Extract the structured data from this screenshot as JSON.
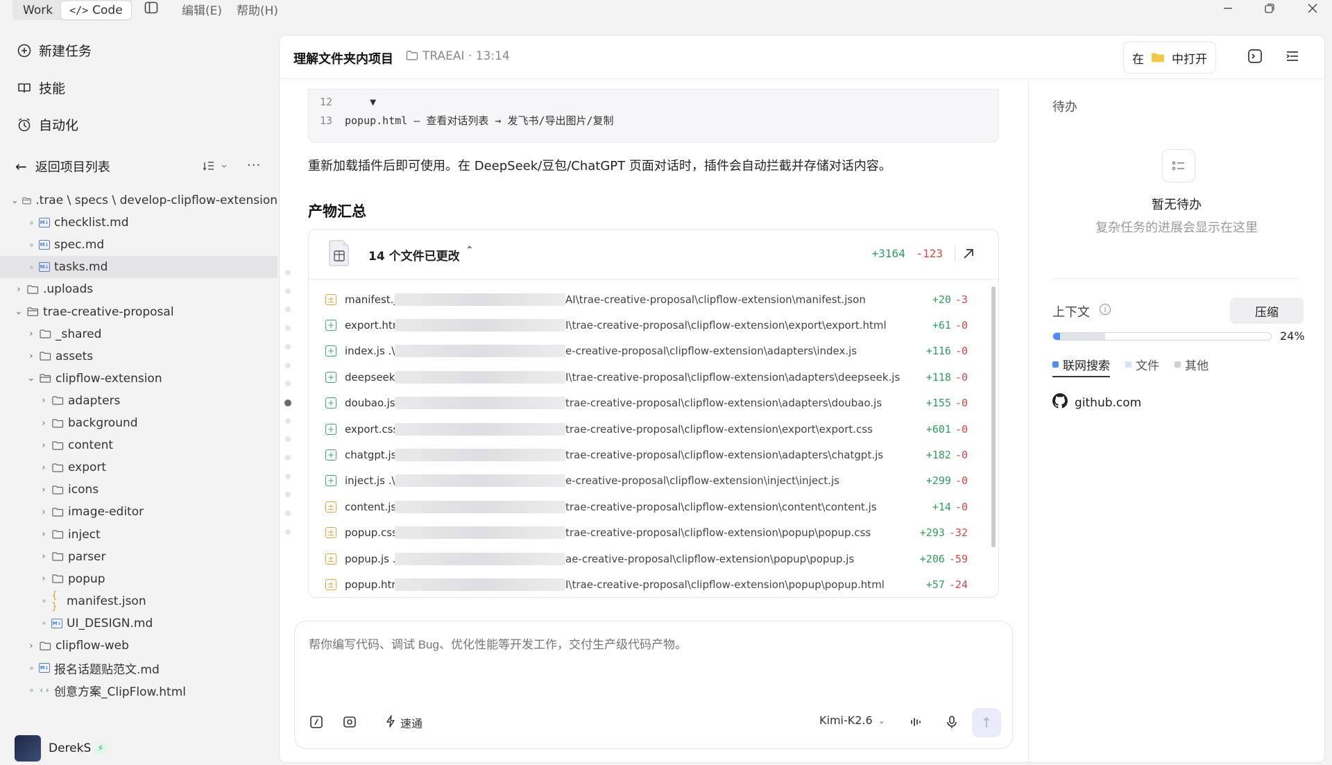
{
  "titlebar": {
    "mode_work": "Work",
    "mode_code": "Code",
    "menu_edit": "编辑(E)",
    "menu_help": "帮助(H)"
  },
  "sidebar": {
    "nav": [
      {
        "label": "新建任务",
        "icon": "plus-circle-icon"
      },
      {
        "label": "技能",
        "icon": "book-icon"
      },
      {
        "label": "自动化",
        "icon": "clock-icon"
      }
    ],
    "back_label": "返回项目列表",
    "tree": [
      {
        "label": ".trae \\ specs \\ develop-clipflow-extension",
        "type": "folder",
        "expanded": true
      },
      {
        "label": "checklist.md",
        "type": "md"
      },
      {
        "label": "spec.md",
        "type": "md"
      },
      {
        "label": "tasks.md",
        "type": "md",
        "selected": true
      },
      {
        "label": ".uploads",
        "type": "folder",
        "expanded": false
      },
      {
        "label": "trae-creative-proposal",
        "type": "folder",
        "expanded": true
      },
      {
        "label": "_shared",
        "type": "folder",
        "expanded": false
      },
      {
        "label": "assets",
        "type": "folder",
        "expanded": false
      },
      {
        "label": "clipflow-extension",
        "type": "folder",
        "expanded": true
      },
      {
        "label": "adapters",
        "type": "folder",
        "expanded": false
      },
      {
        "label": "background",
        "type": "folder",
        "expanded": false
      },
      {
        "label": "content",
        "type": "folder",
        "expanded": false
      },
      {
        "label": "export",
        "type": "folder",
        "expanded": false
      },
      {
        "label": "icons",
        "type": "folder",
        "expanded": false
      },
      {
        "label": "image-editor",
        "type": "folder",
        "expanded": false
      },
      {
        "label": "inject",
        "type": "folder",
        "expanded": false
      },
      {
        "label": "parser",
        "type": "folder",
        "expanded": false
      },
      {
        "label": "popup",
        "type": "folder",
        "expanded": false
      },
      {
        "label": "manifest.json",
        "type": "json"
      },
      {
        "label": "UI_DESIGN.md",
        "type": "md"
      },
      {
        "label": "clipflow-web",
        "type": "folder",
        "expanded": false
      },
      {
        "label": "报名话题贴范文.md",
        "type": "md"
      },
      {
        "label": "创意方案_ClipFlow.html",
        "type": "html"
      }
    ],
    "user_name": "DerekS"
  },
  "header": {
    "title": "理解文件夹内项目",
    "folder_meta": "TRAEAI · 13:14",
    "open_in_prefix": "在",
    "open_in_suffix": "中打开"
  },
  "chat": {
    "code_lines": [
      {
        "num": "12",
        "text": "    ▼"
      },
      {
        "num": "13",
        "text": "popup.html — 查看对话列表 → 发飞书/导出图片/复制"
      }
    ],
    "message": "重新加载插件后即可使用。在 DeepSeek/豆包/ChatGPT 页面对话时，插件会自动拦截并存储对话内容。",
    "section_title": "产物汇总",
    "files_summary": {
      "title": "14 个文件已更改",
      "added": "+3164",
      "removed": "-123",
      "files": [
        {
          "name": "manifest.js",
          "path": "AI\\trae-creative-proposal\\clipflow-extension\\manifest.json",
          "add": "+20",
          "del": "-3",
          "status": "modified"
        },
        {
          "name": "export.htm",
          "path": "I\\trae-creative-proposal\\clipflow-extension\\export\\export.html",
          "add": "+61",
          "del": "-0",
          "status": "added"
        },
        {
          "name": "index.js  .\\(",
          "path": "e-creative-proposal\\clipflow-extension\\adapters\\index.js",
          "add": "+116",
          "del": "-0",
          "status": "added"
        },
        {
          "name": "deepseek.j",
          "path": "I\\trae-creative-proposal\\clipflow-extension\\adapters\\deepseek.js",
          "add": "+118",
          "del": "-0",
          "status": "added"
        },
        {
          "name": "doubao.js",
          "path": "trae-creative-proposal\\clipflow-extension\\adapters\\doubao.js",
          "add": "+155",
          "del": "-0",
          "status": "added"
        },
        {
          "name": "export.css",
          "path": "trae-creative-proposal\\clipflow-extension\\export\\export.css",
          "add": "+601",
          "del": "-0",
          "status": "added"
        },
        {
          "name": "chatgpt.js",
          "path": "trae-creative-proposal\\clipflow-extension\\adapters\\chatgpt.js",
          "add": "+182",
          "del": "-0",
          "status": "added"
        },
        {
          "name": "inject.js  .\\(",
          "path": "e-creative-proposal\\clipflow-extension\\inject\\inject.js",
          "add": "+299",
          "del": "-0",
          "status": "added"
        },
        {
          "name": "content.js",
          "path": "trae-creative-proposal\\clipflow-extension\\content\\content.js",
          "add": "+14",
          "del": "-0",
          "status": "modified"
        },
        {
          "name": "popup.css",
          "path": "trae-creative-proposal\\clipflow-extension\\popup\\popup.css",
          "add": "+293",
          "del": "-32",
          "status": "modified"
        },
        {
          "name": "popup.js  .",
          "path": "ae-creative-proposal\\clipflow-extension\\popup\\popup.js",
          "add": "+206",
          "del": "-59",
          "status": "modified"
        },
        {
          "name": "popup.htm",
          "path": "I\\trae-creative-proposal\\clipflow-extension\\popup\\popup.html",
          "add": "+57",
          "del": "-24",
          "status": "modified"
        }
      ]
    }
  },
  "composer": {
    "placeholder": "帮你编写代码、调试 Bug、优化性能等开发工作，交付生产级代码产物。",
    "speed_label": "速通",
    "model": "Kimi-K2.6"
  },
  "right_pane": {
    "todo_title": "待办",
    "todo_empty_title": "暂无待办",
    "todo_empty_desc": "复杂任务的进展会显示在这里",
    "context_title": "上下文",
    "compress_label": "压缩",
    "context_percent": "24%",
    "context_fraction": 0.24,
    "legend": [
      "联网搜索",
      "文件",
      "其他"
    ],
    "source": "github.com"
  },
  "colors": {
    "accent_blue": "#4c8df6",
    "diff_add": "#2f9e5d",
    "diff_del": "#d24646",
    "modified_icon": "#e5a23a",
    "added_icon": "#3aa46a"
  }
}
